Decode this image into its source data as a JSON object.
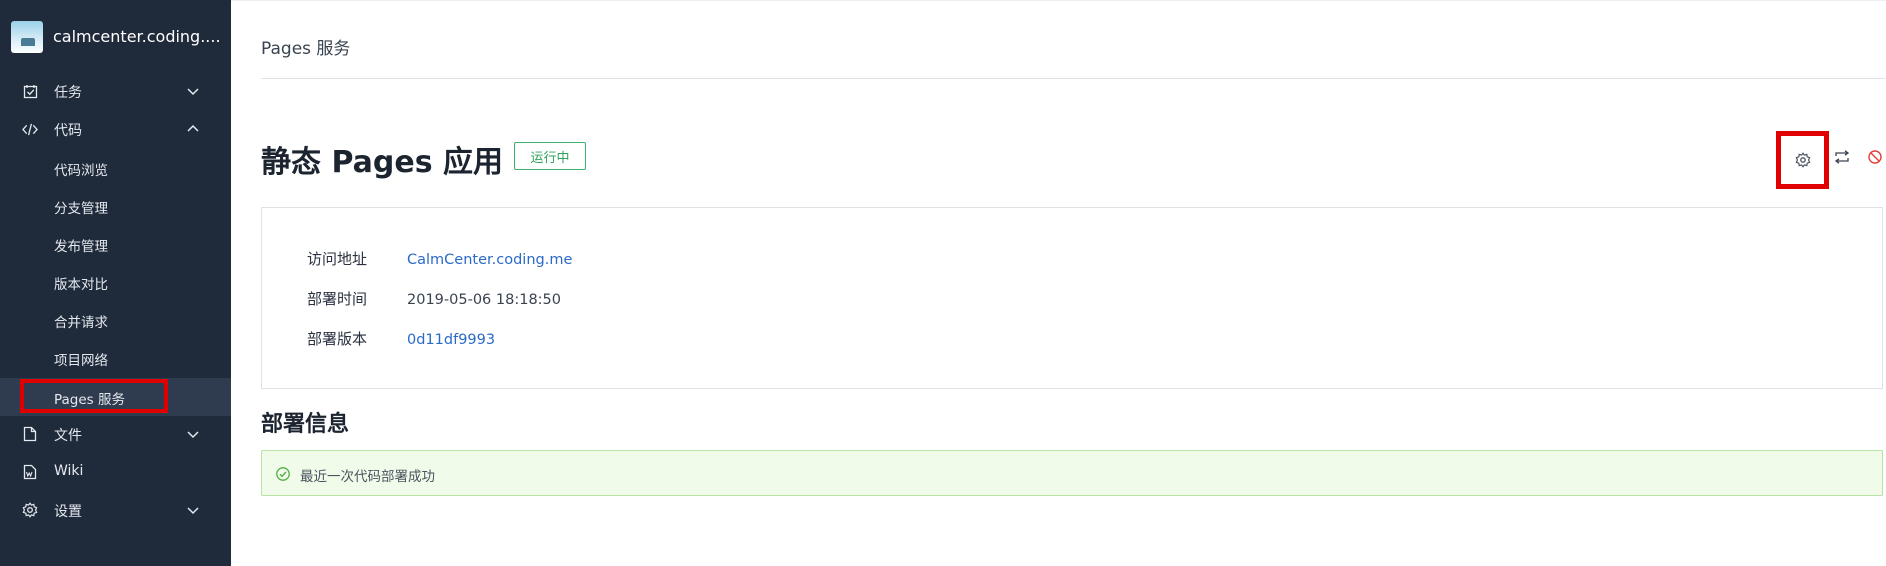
{
  "sidebar": {
    "project_name": "calmcenter.coding....",
    "items": [
      {
        "label": "任务",
        "icon": "checkbox-icon"
      },
      {
        "label": "代码",
        "icon": "code-icon"
      },
      {
        "label": "文件",
        "icon": "file-icon"
      },
      {
        "label": "Wiki",
        "icon": "wiki-icon"
      },
      {
        "label": "设置",
        "icon": "gear-icon"
      }
    ],
    "code_subitems": [
      {
        "label": "代码浏览"
      },
      {
        "label": "分支管理"
      },
      {
        "label": "发布管理"
      },
      {
        "label": "版本对比"
      },
      {
        "label": "合并请求"
      },
      {
        "label": "项目网络"
      },
      {
        "label": "Pages 服务"
      }
    ]
  },
  "main": {
    "breadcrumb": "Pages 服务",
    "title": "静态 Pages 应用",
    "status": "运行中",
    "actions": [
      "gear-icon",
      "swap-icon",
      "disable-icon"
    ],
    "info": [
      {
        "key": "访问地址",
        "value": "CalmCenter.coding.me"
      },
      {
        "key": "部署时间",
        "value": "2019-05-06 18:18:50"
      },
      {
        "key": "部署版本",
        "value": "0d11df9993"
      }
    ],
    "section_title": "部署信息",
    "success_message": "最近一次代码部署成功"
  },
  "colors": {
    "sidebar_bg": "#1f2a3a",
    "highlight_red": "#e00000",
    "success_green": "#2fa35c",
    "link_blue": "#2a6ac8"
  }
}
